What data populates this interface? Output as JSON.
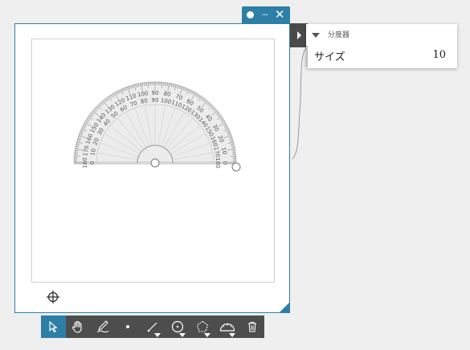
{
  "window": {
    "title_icons": [
      "dot-icon",
      "more-icon",
      "close-icon"
    ]
  },
  "protractor": {
    "outer_labels": [
      "0",
      "10",
      "20",
      "30",
      "40",
      "50",
      "60",
      "70",
      "80",
      "90",
      "100",
      "110",
      "120",
      "130",
      "140",
      "150",
      "160",
      "170",
      "180"
    ],
    "inner_labels": [
      "180",
      "170",
      "160",
      "150",
      "140",
      "130",
      "120",
      "110",
      "100",
      "90",
      "80",
      "70",
      "60",
      "50",
      "40",
      "30",
      "20",
      "10",
      "0"
    ]
  },
  "properties": {
    "section_title": "分度器",
    "size_label": "サイズ",
    "size_value": "10"
  },
  "toolbar": {
    "tools": [
      "select-tool",
      "pan-tool",
      "pen-tool",
      "point-tool",
      "line-tool",
      "circle-tool",
      "polygon-tool",
      "protractor-tool",
      "delete-tool"
    ],
    "active": "select-tool"
  },
  "colors": {
    "accent": "#2d7fa6",
    "toolbar": "#4d4d4d"
  }
}
